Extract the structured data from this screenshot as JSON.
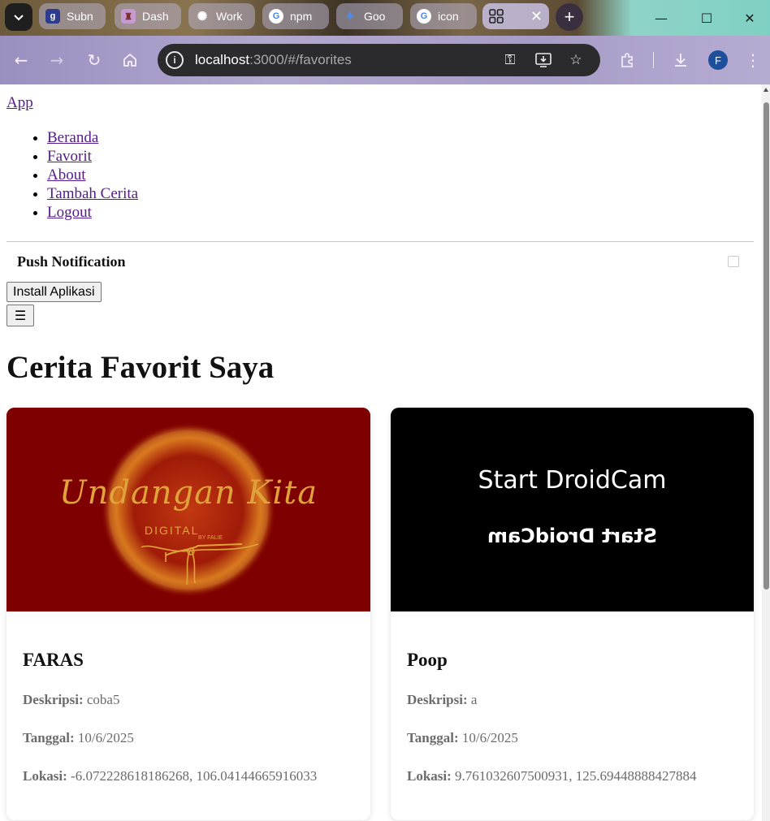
{
  "browser": {
    "tabs": [
      {
        "label": "Subn",
        "favicon": "g-logo-icon"
      },
      {
        "label": "Dash",
        "favicon": "shield-crest-icon"
      },
      {
        "label": "Work",
        "favicon": "openai-icon"
      },
      {
        "label": "npm",
        "favicon": "google-icon"
      },
      {
        "label": "Goo",
        "favicon": "gemini-icon"
      },
      {
        "label": "icon",
        "favicon": "google-icon"
      },
      {
        "label": "",
        "favicon": "grid-icon",
        "active": true
      }
    ],
    "url_host": "localhost",
    "url_rest": ":3000/#/favorites",
    "profile_initial": "F"
  },
  "nav": {
    "brand": "App",
    "items": [
      {
        "label": "Beranda"
      },
      {
        "label": "Favorit"
      },
      {
        "label": "About"
      },
      {
        "label": "Tambah Cerita"
      },
      {
        "label": "Logout"
      }
    ]
  },
  "push": {
    "label": "Push Notification",
    "checked": false
  },
  "install_label": "Install Aplikasi",
  "menu_toggle_label": "☰",
  "page_title": "Cerita Favorit Saya",
  "stories": [
    {
      "image_text": "Undangan Kita",
      "image_subtext": "DIGITAL",
      "image_small": "BY FALIE",
      "name": "FARAS",
      "desc_label": "Deskripsi:",
      "desc": "coba5",
      "date_label": "Tanggal:",
      "date": "10/6/2025",
      "loc_label": "Lokasi:",
      "loc": "-6.072228618186268, 106.04144665916033"
    },
    {
      "image_text": "Start DroidCam",
      "name": "Poop",
      "desc_label": "Deskripsi:",
      "desc": "a",
      "date_label": "Tanggal:",
      "date": "10/6/2025",
      "loc_label": "Lokasi:",
      "loc": "9.761032607500931, 125.69448888427884"
    }
  ],
  "colors": {
    "link": "#551a8b",
    "card1_bg": "#7f0000",
    "card2_bg": "#000000",
    "gold": "#e0a23a"
  }
}
